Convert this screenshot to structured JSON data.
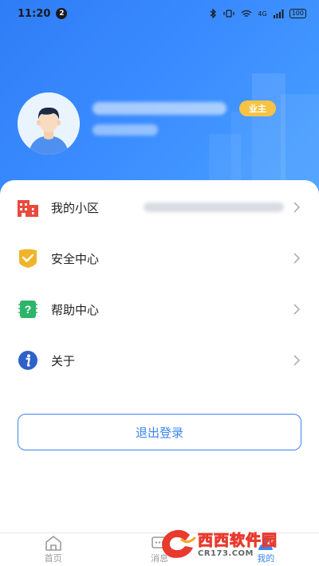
{
  "status_bar": {
    "time": "11:20",
    "notification_count": "2",
    "signal_text": "4G",
    "battery": "100"
  },
  "profile": {
    "role_badge": "业主"
  },
  "menu": {
    "items": [
      {
        "label": "我的小区",
        "icon": "building-icon"
      },
      {
        "label": "安全中心",
        "icon": "shield-check-icon"
      },
      {
        "label": "帮助中心",
        "icon": "help-chip-icon"
      },
      {
        "label": "关于",
        "icon": "info-icon"
      }
    ]
  },
  "logout_label": "退出登录",
  "tabbar": {
    "tabs": [
      {
        "label": "首页",
        "icon": "home-icon"
      },
      {
        "label": "消息",
        "icon": "message-icon"
      },
      {
        "label": "我的",
        "icon": "profile-icon",
        "active": true
      }
    ]
  },
  "watermark": {
    "name": "西西软件园",
    "url": "CR173.COM"
  },
  "colors": {
    "header_gradient_start": "#2f7df6",
    "header_gradient_end": "#4aa2ff",
    "accent": "#3b86f0",
    "badge": "#f6c344"
  }
}
